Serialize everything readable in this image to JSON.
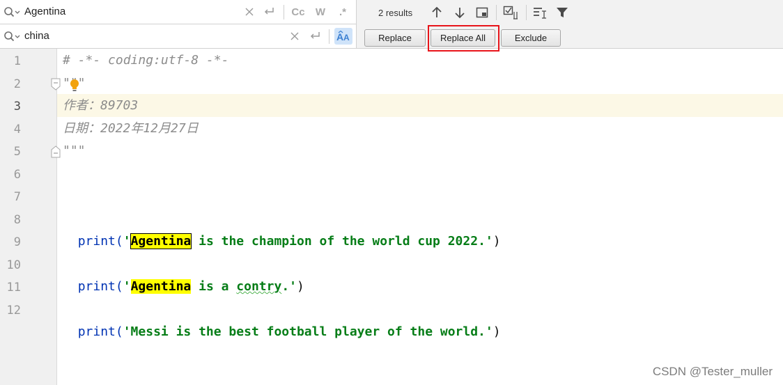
{
  "find": {
    "value": "Agentina",
    "icons": [
      "search-history-icon",
      "clear-icon",
      "newline-icon",
      "match-case-icon",
      "whole-words-icon",
      "regex-icon"
    ],
    "match_case_label": "Cc",
    "whole_words_label": "W",
    "regex_label": ".*"
  },
  "replace": {
    "value": "china",
    "icons": [
      "search-history-icon",
      "clear-icon",
      "newline-icon",
      "preserve-case-icon"
    ]
  },
  "results_text": "2 results",
  "toolbar_icons": [
    "arrow-up-icon",
    "arrow-down-icon",
    "select-all-occurrences-icon",
    "in-selection-icon",
    "multiline-icon",
    "filter-icon"
  ],
  "buttons": {
    "replace": "Replace",
    "replace_all": "Replace All",
    "exclude": "Exclude"
  },
  "colors": {
    "match_highlight": "#ffff00",
    "callout_box": "#e8141a",
    "string_green": "#067d17",
    "keyword_blue": "#0033b3",
    "comment_gray": "#8c8c8c",
    "current_line": "#fcf8e6"
  },
  "editor": {
    "line_numbers": [
      "1",
      "2",
      "3",
      "4",
      "5",
      "6",
      "7",
      "8",
      "9",
      "10",
      "11",
      "12"
    ],
    "current_line": "3",
    "lines": {
      "l1": "# -*- coding:utf-8 -*-",
      "l2": "\"\"\"",
      "l3": "作者：89703",
      "l4": "日期：2022年12月27日",
      "l5": "\"\"\"",
      "l8": {
        "func": "print(",
        "open_quote": "'",
        "match": "Agentina",
        "rest": " is the champion of the world cup 2022.'",
        "close": ")"
      },
      "l10": {
        "func": "print(",
        "open_quote": "'",
        "match": "Agentina",
        "mid": " is a ",
        "typo": "contry",
        "rest": ".'",
        "close": ")"
      },
      "l12": {
        "func": "print(",
        "str": "'Messi is the best football player of the world.'",
        "close": ")"
      }
    }
  },
  "watermark": "CSDN @Tester_muller"
}
